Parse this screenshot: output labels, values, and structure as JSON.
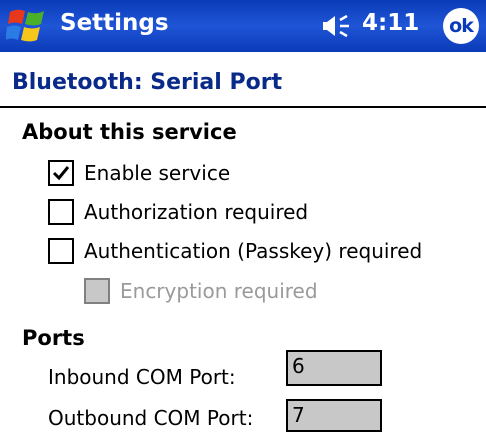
{
  "titlebar": {
    "title": "Settings",
    "time": "4:11",
    "ok_label": "ok",
    "colors": {
      "background": "#0a3bb8",
      "text": "#ffffff"
    }
  },
  "page": {
    "title": "Bluetooth: Serial Port",
    "title_color": "#0a2a8a"
  },
  "about": {
    "heading": "About this service",
    "options": [
      {
        "label": "Enable service",
        "checked": true,
        "enabled": true
      },
      {
        "label": "Authorization required",
        "checked": false,
        "enabled": true
      },
      {
        "label": "Authentication (Passkey) required",
        "checked": false,
        "enabled": true
      },
      {
        "label": "Encryption required",
        "checked": false,
        "enabled": false
      }
    ]
  },
  "ports": {
    "heading": "Ports",
    "inbound": {
      "label": "Inbound COM Port:",
      "value": "6"
    },
    "outbound": {
      "label": "Outbound COM Port:",
      "value": "7"
    }
  },
  "icons": [
    "windows-start-icon",
    "speaker-icon",
    "check-icon"
  ]
}
